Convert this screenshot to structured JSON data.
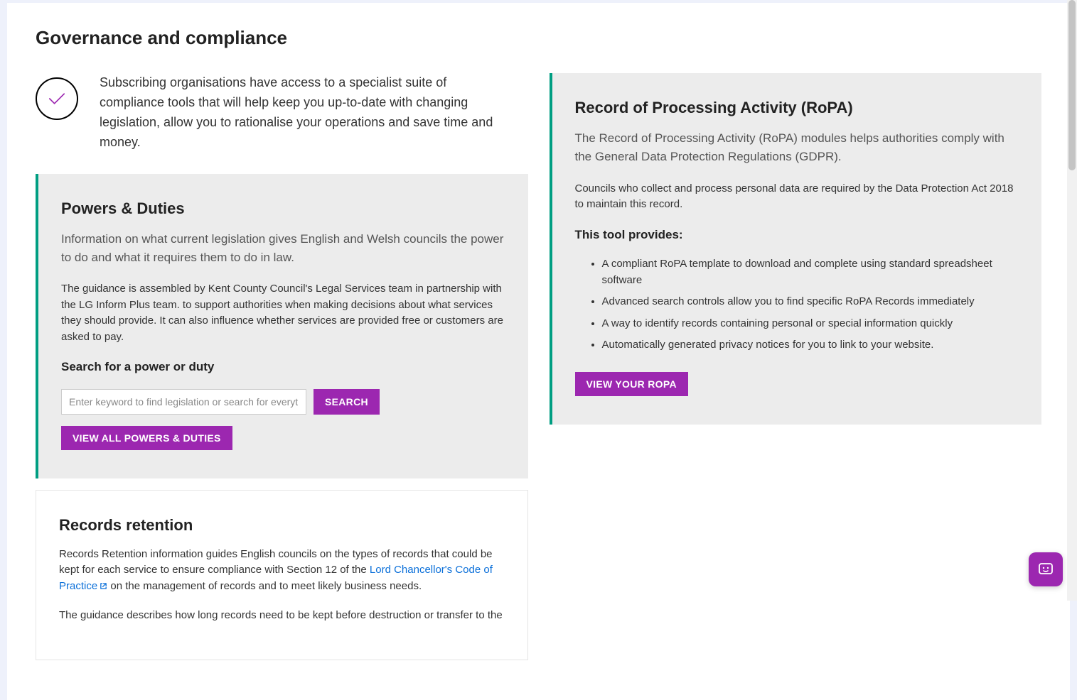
{
  "page": {
    "title": "Governance and compliance",
    "intro_text": "Subscribing organisations have access to a specialist suite of compliance tools that will help keep you up-to-date with changing legislation, allow you to rationalise your operations and save time and money."
  },
  "powers": {
    "heading": "Powers & Duties",
    "lead": "Information on what current legislation gives English and Welsh councils the power to do and what it requires them to do in law.",
    "body": "The guidance is assembled by Kent County Council's Legal Services team in partnership with the LG Inform Plus team. to support authorities when making decisions about what services they should provide. It can also influence whether services are provided free or customers are asked to pay.",
    "search_heading": "Search for a power or duty",
    "search_placeholder": "Enter keyword to find legislation or search for everythin",
    "search_button": "SEARCH",
    "view_all_button": "VIEW ALL POWERS & DUTIES"
  },
  "records": {
    "heading": "Records retention",
    "body_part1": "Records Retention information guides English councils on the types of records that could be kept for each service to ensure compliance with Section 12 of the ",
    "link_text": "Lord Chancellor's Code of Practice",
    "body_part2": " on the management of records and to meet likely business needs.",
    "body2": "The guidance describes how long records need to be kept before destruction or transfer to the"
  },
  "ropa": {
    "heading": "Record of Processing Activity (RoPA)",
    "lead": "The Record of Processing Activity (RoPA) modules helps authorities comply with the General Data Protection Regulations (GDPR).",
    "body": "Councils who collect and process personal data are required by the Data Protection Act 2018 to maintain this record.",
    "list_heading": "This tool provides:",
    "items": [
      "A compliant RoPA template to download and complete using standard spreadsheet software",
      "Advanced search controls allow you to find specific RoPA Records immediately",
      "A way to identify records containing personal or special information quickly",
      "Automatically generated privacy notices for you to link to your website."
    ],
    "button": "VIEW YOUR ROPA"
  },
  "icons": {
    "intro": "checkmark-circle-icon",
    "external": "external-link-icon",
    "chat": "chat-smile-icon"
  }
}
